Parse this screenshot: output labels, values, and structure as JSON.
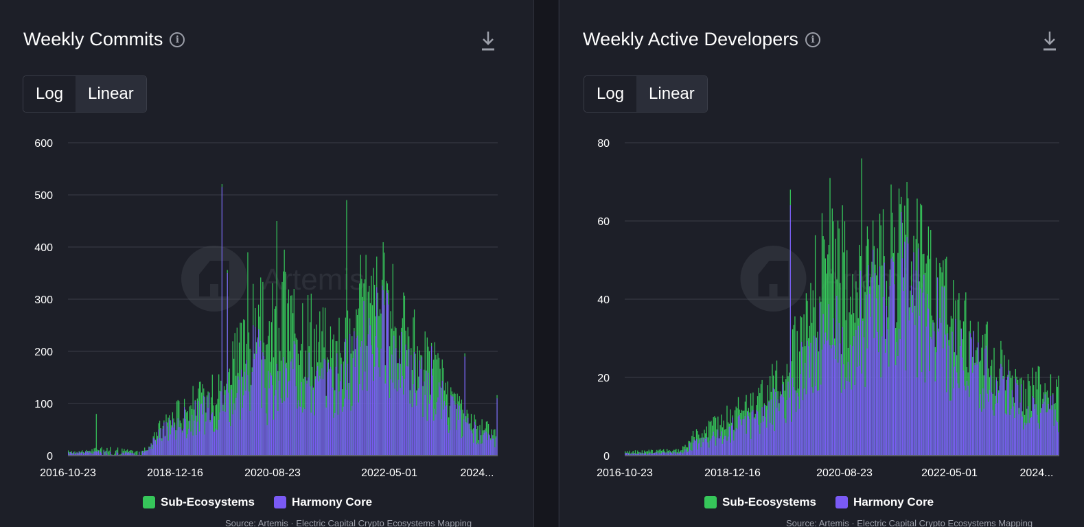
{
  "colors": {
    "sub": "#36c65a",
    "core": "#7a5af5",
    "grid": "#3b3e49",
    "axis_text": "#ffffff"
  },
  "watermark": "Artemis",
  "source_text": "Source: Artemis · Electric Capital Crypto Ecosystems Mapping",
  "legend": {
    "sub": "Sub-Ecosystems",
    "core": "Harmony Core"
  },
  "panels": [
    {
      "title": "Weekly Commits",
      "toggle": {
        "log": "Log",
        "linear": "Linear",
        "active": "linear"
      }
    },
    {
      "title": "Weekly Active Developers",
      "toggle": {
        "log": "Log",
        "linear": "Linear",
        "active": "linear"
      }
    }
  ],
  "chart_data": [
    {
      "type": "bar",
      "stacked": true,
      "title": "Weekly Commits",
      "x_tick_labels": [
        "2016-10-23",
        "2018-12-16",
        "2020-08-23",
        "2022-05-01",
        "2024..."
      ],
      "ylim": [
        0,
        600
      ],
      "y_ticks": [
        0,
        100,
        200,
        300,
        400,
        500,
        600
      ],
      "grid": true,
      "legend_position": "bottom-center",
      "x_start": "2016-10-23",
      "x_end": "2024-07-28",
      "series": [
        {
          "name": "Harmony Core",
          "envelope": [
            [
              0,
              5
            ],
            [
              40,
              8
            ],
            [
              60,
              5
            ],
            [
              75,
              12
            ],
            [
              85,
              45
            ],
            [
              105,
              70
            ],
            [
              130,
              90
            ],
            [
              150,
              110
            ],
            [
              165,
              160
            ],
            [
              175,
              200
            ],
            [
              185,
              120
            ],
            [
              200,
              150
            ],
            [
              215,
              170
            ],
            [
              235,
              140
            ],
            [
              250,
              150
            ],
            [
              265,
              190
            ],
            [
              280,
              240
            ],
            [
              290,
              270
            ],
            [
              300,
              220
            ],
            [
              315,
              170
            ],
            [
              330,
              140
            ],
            [
              345,
              120
            ],
            [
              355,
              90
            ],
            [
              370,
              60
            ],
            [
              385,
              40
            ],
            [
              400,
              30
            ]
          ],
          "peaks": [
            [
              143,
              515
            ],
            [
              148,
              350
            ],
            [
              172,
              250
            ],
            [
              269,
              230
            ],
            [
              309,
              130
            ],
            [
              338,
              210
            ],
            [
              369,
              190
            ],
            [
              399,
              110
            ]
          ]
        },
        {
          "name": "Sub-Ecosystems",
          "envelope": [
            [
              0,
              8
            ],
            [
              40,
              15
            ],
            [
              60,
              8
            ],
            [
              75,
              15
            ],
            [
              85,
              55
            ],
            [
              105,
              95
            ],
            [
              130,
              120
            ],
            [
              150,
              160
            ],
            [
              165,
              230
            ],
            [
              175,
              280
            ],
            [
              185,
              250
            ],
            [
              200,
              280
            ],
            [
              215,
              300
            ],
            [
              235,
              230
            ],
            [
              250,
              220
            ],
            [
              265,
              250
            ],
            [
              280,
              310
            ],
            [
              290,
              330
            ],
            [
              300,
              290
            ],
            [
              315,
              240
            ],
            [
              330,
              200
            ],
            [
              345,
              160
            ],
            [
              355,
              110
            ],
            [
              370,
              75
            ],
            [
              385,
              55
            ],
            [
              400,
              45
            ]
          ],
          "peaks": [
            [
              26,
              80
            ],
            [
              167,
              390
            ],
            [
              194,
              450
            ],
            [
              201,
              395
            ],
            [
              259,
              490
            ],
            [
              272,
              385
            ],
            [
              277,
              385
            ],
            [
              196,
              245
            ],
            [
              183,
              185
            ]
          ]
        }
      ]
    },
    {
      "type": "bar",
      "stacked": true,
      "title": "Weekly Active Developers",
      "x_tick_labels": [
        "2016-10-23",
        "2018-12-16",
        "2020-08-23",
        "2022-05-01",
        "2024..."
      ],
      "ylim": [
        0,
        80
      ],
      "y_ticks": [
        0,
        20,
        40,
        60,
        80
      ],
      "grid": true,
      "legend_position": "bottom-center",
      "x_start": "2016-10-23",
      "x_end": "2024-07-28",
      "series": [
        {
          "name": "Harmony Core",
          "envelope": [
            [
              0,
              0.5
            ],
            [
              50,
              0.8
            ],
            [
              60,
              3
            ],
            [
              80,
              5
            ],
            [
              100,
              8
            ],
            [
              120,
              10
            ],
            [
              135,
              14
            ],
            [
              150,
              20
            ],
            [
              160,
              25
            ],
            [
              175,
              30
            ],
            [
              190,
              33
            ],
            [
              210,
              37
            ],
            [
              230,
              42
            ],
            [
              240,
              48
            ],
            [
              250,
              46
            ],
            [
              265,
              40
            ],
            [
              280,
              34
            ],
            [
              290,
              30
            ],
            [
              300,
              26
            ],
            [
              315,
              22
            ],
            [
              330,
              18
            ],
            [
              345,
              15
            ],
            [
              360,
              13
            ],
            [
              375,
              12
            ],
            [
              384,
              11
            ]
          ],
          "peaks": [
            [
              146,
              64
            ],
            [
              255,
              52
            ]
          ]
        },
        {
          "name": "Sub-Ecosystems",
          "envelope": [
            [
              0,
              1
            ],
            [
              50,
              1.5
            ],
            [
              60,
              5
            ],
            [
              80,
              8
            ],
            [
              100,
              12
            ],
            [
              120,
              15
            ],
            [
              135,
              20
            ],
            [
              150,
              28
            ],
            [
              160,
              38
            ],
            [
              175,
              50
            ],
            [
              190,
              48
            ],
            [
              200,
              45
            ],
            [
              210,
              45
            ],
            [
              230,
              52
            ],
            [
              240,
              56
            ],
            [
              250,
              55
            ],
            [
              265,
              50
            ],
            [
              280,
              44
            ],
            [
              290,
              37
            ],
            [
              300,
              33
            ],
            [
              315,
              28
            ],
            [
              330,
              24
            ],
            [
              345,
              20
            ],
            [
              360,
              18
            ],
            [
              375,
              17
            ],
            [
              384,
              16
            ]
          ],
          "peaks": [
            [
              146,
              68
            ],
            [
              181,
              71
            ],
            [
              209,
              76
            ],
            [
              192,
              64
            ],
            [
              174,
              62
            ],
            [
              223,
              53
            ]
          ]
        }
      ]
    }
  ]
}
